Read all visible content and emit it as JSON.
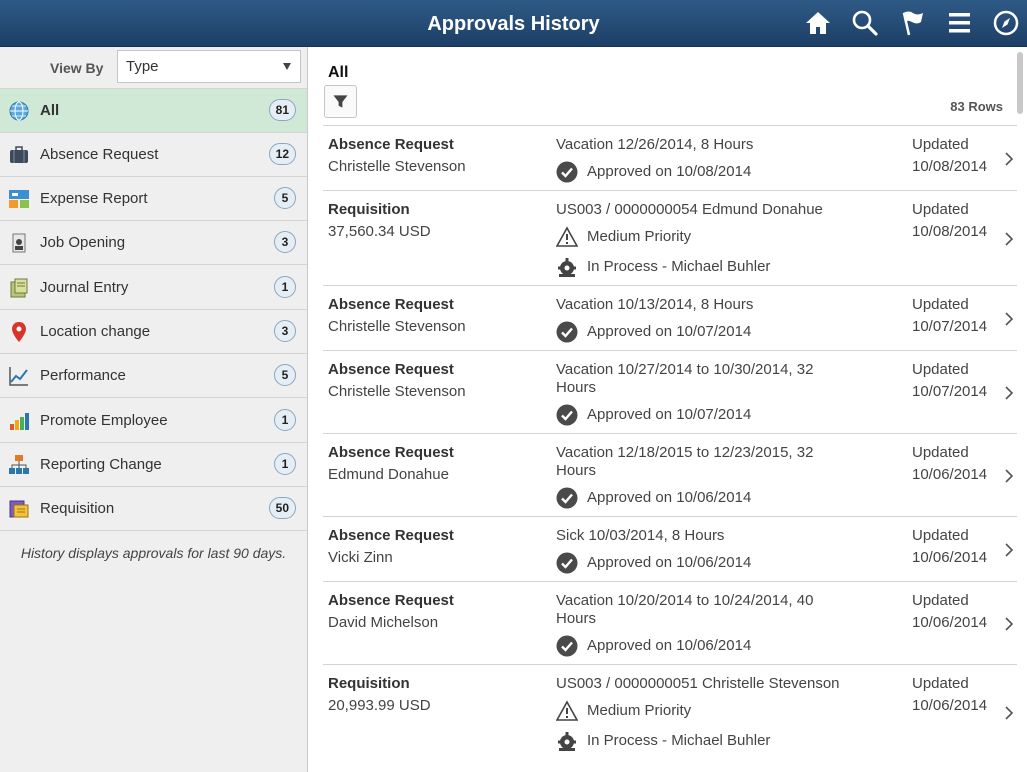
{
  "header": {
    "title": "Approvals History"
  },
  "sidebar": {
    "view_by_label": "View By",
    "view_by_value": "Type",
    "items": [
      {
        "label": "All",
        "count": "81"
      },
      {
        "label": "Absence Request",
        "count": "12"
      },
      {
        "label": "Expense Report",
        "count": "5"
      },
      {
        "label": "Job Opening",
        "count": "3"
      },
      {
        "label": "Journal Entry",
        "count": "1"
      },
      {
        "label": "Location change",
        "count": "3"
      },
      {
        "label": "Performance",
        "count": "5"
      },
      {
        "label": "Promote Employee",
        "count": "1"
      },
      {
        "label": "Reporting Change",
        "count": "1"
      },
      {
        "label": "Requisition",
        "count": "50"
      }
    ],
    "footnote": "History displays approvals for last 90 days."
  },
  "main": {
    "title": "All",
    "rows_count": "83 Rows",
    "rows": [
      {
        "type": "Absence Request",
        "who": "Christelle Stevenson",
        "desc": "Vacation 12/26/2014, 8 Hours",
        "status1": "Approved on 10/08/2014",
        "status2": "",
        "updated": "Updated",
        "date": "10/08/2014"
      },
      {
        "type": "Requisition",
        "who": "37,560.34 USD",
        "desc": "US003 / 0000000054 Edmund Donahue",
        "status1": "Medium Priority",
        "status2": "In Process - Michael Buhler",
        "updated": "Updated",
        "date": "10/08/2014"
      },
      {
        "type": "Absence Request",
        "who": "Christelle Stevenson",
        "desc": "Vacation 10/13/2014, 8 Hours",
        "status1": "Approved on 10/07/2014",
        "status2": "",
        "updated": "Updated",
        "date": "10/07/2014"
      },
      {
        "type": "Absence Request",
        "who": "Christelle Stevenson",
        "desc": "Vacation 10/27/2014 to  10/30/2014, 32 Hours",
        "status1": "Approved on 10/07/2014",
        "status2": "",
        "updated": "Updated",
        "date": "10/07/2014"
      },
      {
        "type": "Absence Request",
        "who": "Edmund Donahue",
        "desc": "Vacation 12/18/2015 to  12/23/2015, 32 Hours",
        "status1": "Approved on 10/06/2014",
        "status2": "",
        "updated": "Updated",
        "date": "10/06/2014"
      },
      {
        "type": "Absence Request",
        "who": "Vicki Zinn",
        "desc": "Sick 10/03/2014, 8 Hours",
        "status1": "Approved on 10/06/2014",
        "status2": "",
        "updated": "Updated",
        "date": "10/06/2014"
      },
      {
        "type": "Absence Request",
        "who": "David Michelson",
        "desc": "Vacation 10/20/2014 to  10/24/2014, 40 Hours",
        "status1": "Approved on 10/06/2014",
        "status2": "",
        "updated": "Updated",
        "date": "10/06/2014"
      },
      {
        "type": "Requisition",
        "who": "20,993.99 USD",
        "desc": "US003 / 0000000051 Christelle Stevenson",
        "status1": "Medium Priority",
        "status2": "In Process - Michael Buhler",
        "updated": "Updated",
        "date": "10/06/2014"
      }
    ]
  }
}
